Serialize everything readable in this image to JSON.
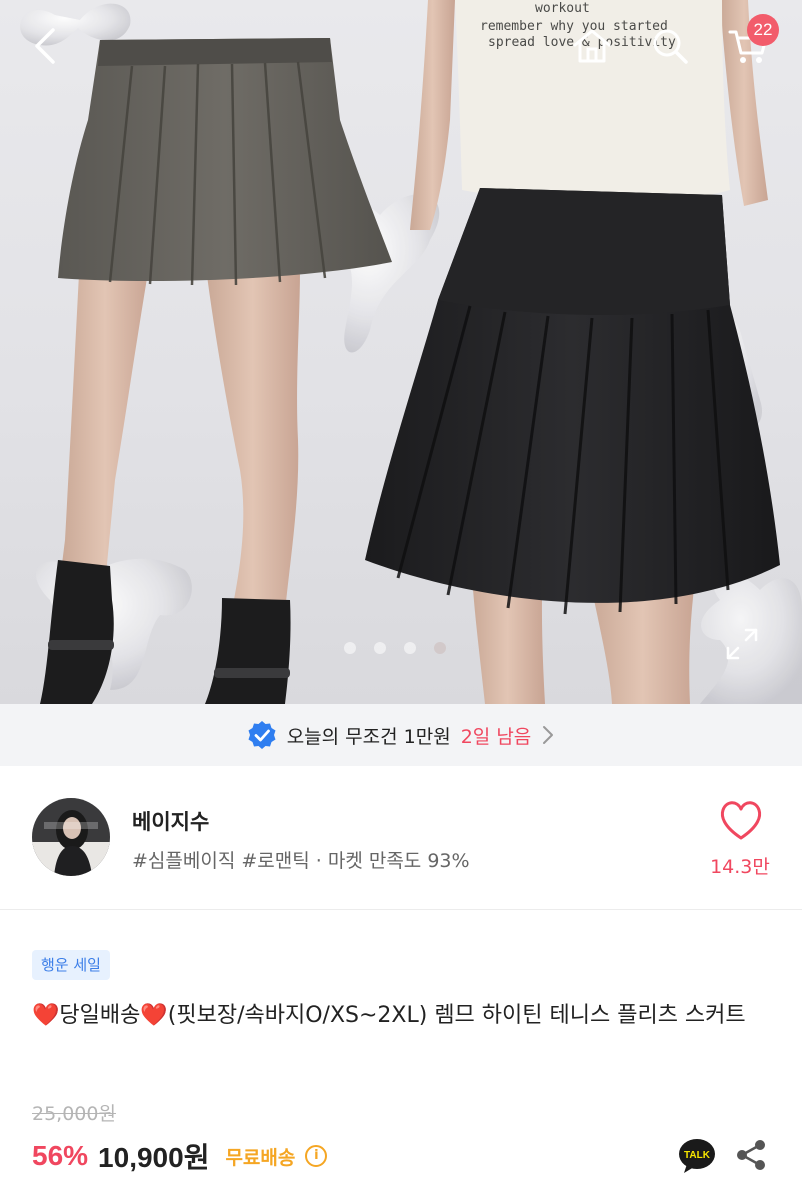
{
  "header": {
    "back_icon": "back-arrow-icon",
    "home_icon": "home-icon",
    "search_icon": "search-icon",
    "cart_icon": "cart-icon",
    "cart_count": "22",
    "shirt_text": [
      "workout",
      "remember why you started",
      "spread love & positivity"
    ]
  },
  "carousel": {
    "dot_count": 4,
    "active_index": 3,
    "expand_icon": "expand-icon"
  },
  "promo": {
    "icon": "verified-check-icon",
    "text": "오늘의 무조건 1만원",
    "highlight": "2일 남음",
    "chevron_icon": "chevron-right-icon"
  },
  "shop": {
    "name": "베이지수",
    "tags": "#심플베이직 #로맨틱 · 마켓 만족도 93%",
    "like_icon": "heart-icon",
    "like_count": "14.3만"
  },
  "product": {
    "badge": "행운 세일",
    "title_prefix": "❤️",
    "title_mid": "당일배송",
    "title_suffix": "(핏보장/속바지O/XS~2XL) 렘므 하이틴 테니스 플리츠 스커트",
    "original_price": "25,000원",
    "discount": "56%",
    "price": "10,900원",
    "shipping": "무료배송",
    "info_icon": "info-icon",
    "talk_label": "TALK",
    "share_icon": "share-icon"
  },
  "colors": {
    "accent": "#f0475f",
    "shipping": "#f5a623",
    "badge_bg": "#e7f1fe",
    "badge_text": "#3d7fe8",
    "promo_bg": "#f3f4f6"
  }
}
